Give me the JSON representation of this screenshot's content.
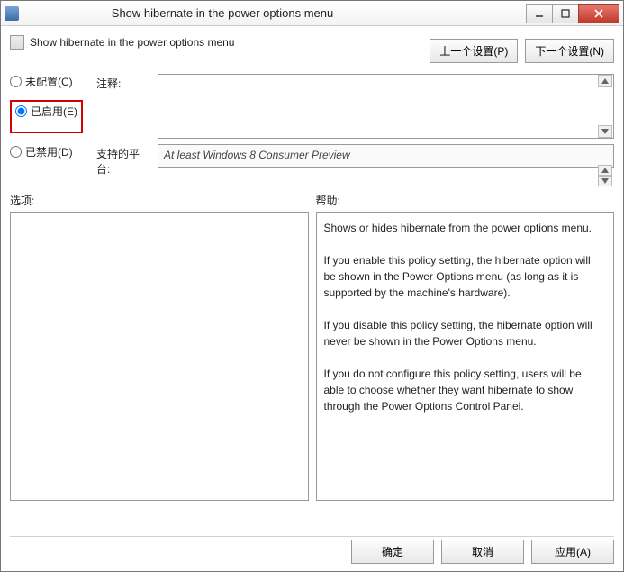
{
  "window": {
    "title": "Show hibernate in the power options menu"
  },
  "policy": {
    "header": "Show hibernate in the power options menu"
  },
  "nav": {
    "prev": "上一个设置(P)",
    "next": "下一个设置(N)"
  },
  "radios": {
    "not_configured": "未配置(C)",
    "enabled": "已启用(E)",
    "disabled": "已禁用(D)",
    "selected": "enabled"
  },
  "labels": {
    "comment": "注释:",
    "supported": "支持的平台:",
    "options": "选项:",
    "help": "帮助:"
  },
  "fields": {
    "comment": "",
    "supported": "At least Windows 8 Consumer Preview"
  },
  "help_text": "Shows or hides hibernate from the power options menu.\n\nIf you enable this policy setting, the hibernate option will be shown in the Power Options menu (as long as it is supported by the machine's hardware).\n\nIf you disable this policy setting, the hibernate option will never be shown in the Power Options menu.\n\nIf you do not configure this policy setting, users will be able to choose whether they want hibernate to show through the Power Options Control Panel.",
  "buttons": {
    "ok": "确定",
    "cancel": "取消",
    "apply": "应用(A)"
  }
}
